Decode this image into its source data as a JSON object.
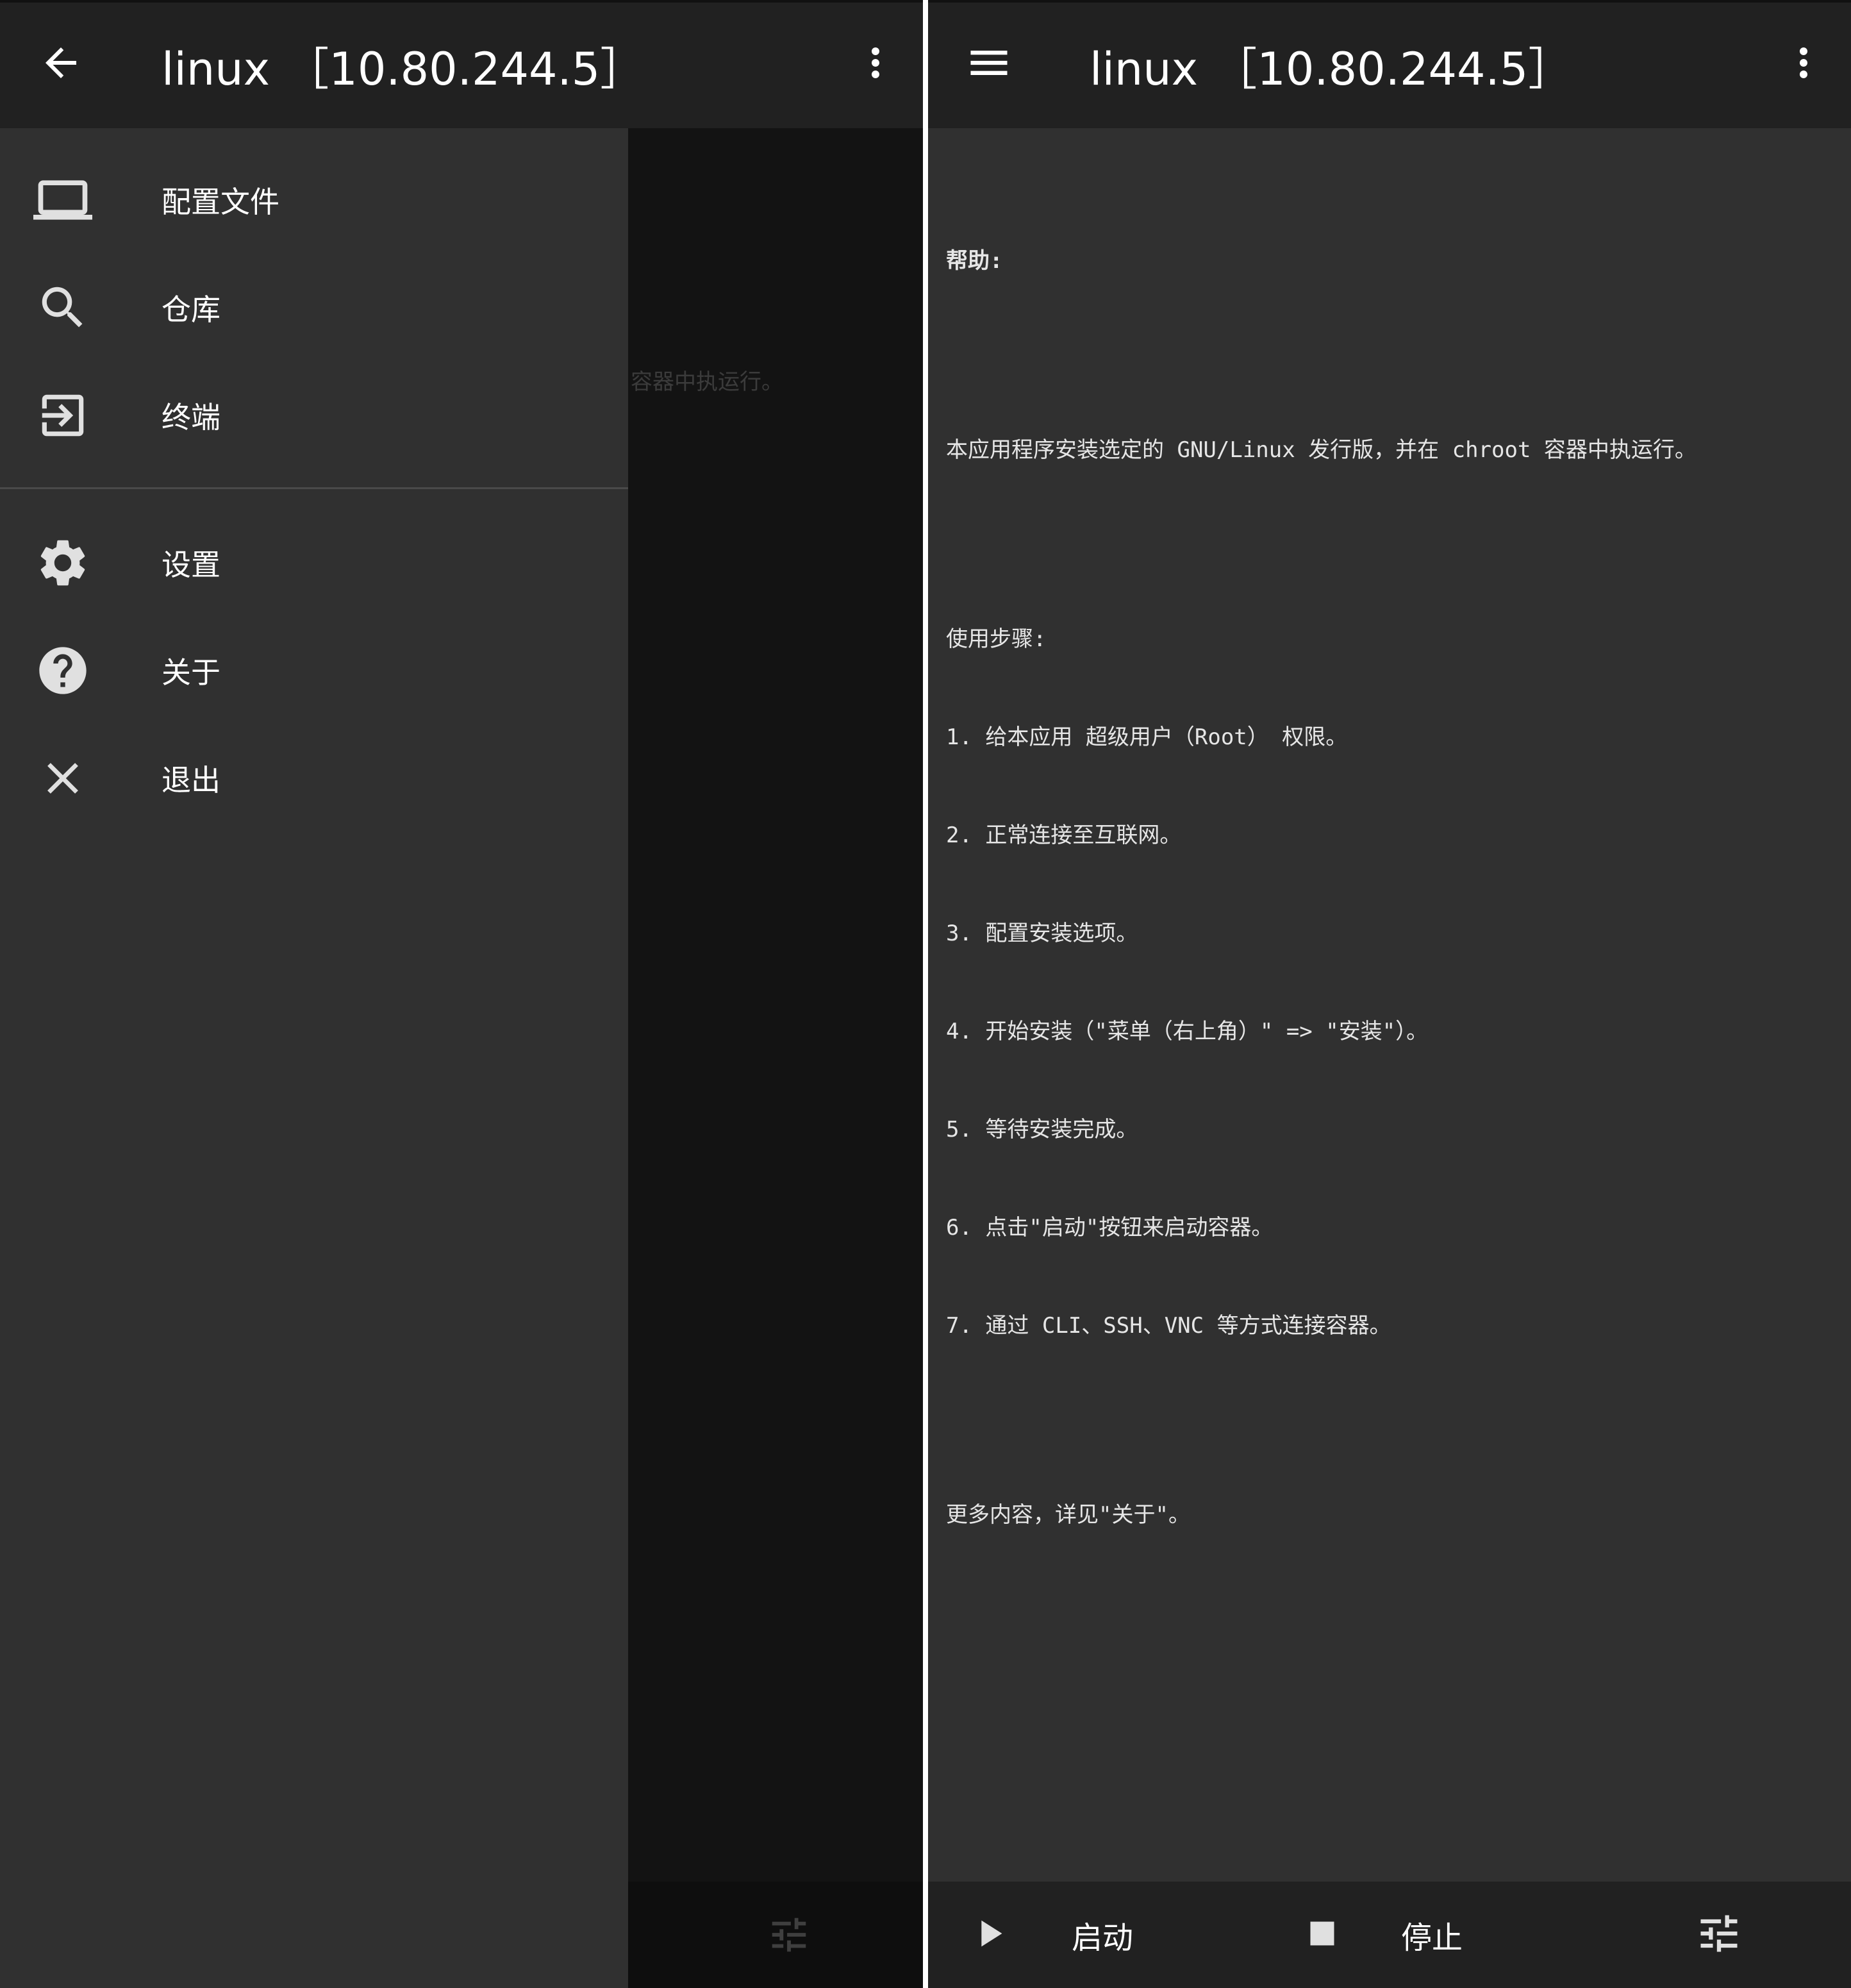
{
  "left_screen": {
    "app_bar": {
      "nav_icon": "arrow-back-icon",
      "title": "linux ［10.80.244.5］",
      "more_icon": "more-vert-icon"
    },
    "background_text_fragment": "容器中执运行。",
    "drawer": {
      "items": [
        {
          "label": "配置文件",
          "icon": "laptop-icon"
        },
        {
          "label": "仓库",
          "icon": "search-icon"
        },
        {
          "label": "终端",
          "icon": "login-icon"
        },
        {
          "label": "设置",
          "icon": "gear-icon"
        },
        {
          "label": "关于",
          "icon": "help-icon"
        },
        {
          "label": "退出",
          "icon": "close-icon"
        }
      ]
    },
    "bottom_bar": {
      "tune_icon": "tune-icon"
    }
  },
  "right_screen": {
    "app_bar": {
      "nav_icon": "menu-icon",
      "title": "linux ［10.80.244.5］",
      "more_icon": "more-vert-icon"
    },
    "help": {
      "heading": "帮助:",
      "description": "本应用程序安装选定的 GNU/Linux 发行版，并在 chroot 容器中执运行。",
      "steps_heading": "使用步骤:",
      "steps": [
        "1. 给本应用 超级用户（Root） 权限。",
        "2. 正常连接至互联网。",
        "3. 配置安装选项。",
        "4. 开始安装（\"菜单（右上角）\" => \"安装\"）。",
        "5. 等待安装完成。",
        "6. 点击\"启动\"按钮来启动容器。",
        "7. 通过 CLI、SSH、VNC 等方式连接容器。"
      ],
      "more": "更多内容，详见\"关于\"。"
    },
    "bottom_bar": {
      "start_label": "启动",
      "stop_label": "停止",
      "start_icon": "play-icon",
      "stop_icon": "stop-icon",
      "tune_icon": "tune-icon"
    }
  },
  "colors": {
    "app_bar": "#212121",
    "background": "#303030",
    "text": "#ffffff",
    "icon": "#e0e0e0",
    "divider": "#ffffff"
  }
}
